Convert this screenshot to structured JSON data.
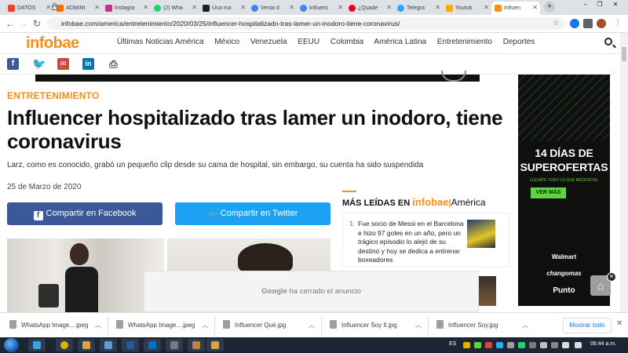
{
  "browser": {
    "tabs": [
      {
        "label": "DATOS",
        "color": "#ea4335"
      },
      {
        "label": "ADMINI",
        "color": "#ff6d00"
      },
      {
        "label": "Instagra",
        "color": "#c13584"
      },
      {
        "label": "(2) Wha",
        "color": "#25d366"
      },
      {
        "label": "Una ma",
        "color": "#202124"
      },
      {
        "label": "Venta d",
        "color": "#4285f4"
      },
      {
        "label": "Influenc",
        "color": "#4285f4"
      },
      {
        "label": "¿Quade",
        "color": "#e60023"
      },
      {
        "label": "Telegra",
        "color": "#2aabee"
      },
      {
        "label": "Youtub",
        "color": "#f9ab00"
      },
      {
        "label": "Influen",
        "color": "#f68e1e"
      }
    ],
    "url": "infobae.com/america/entretenimiento/2020/03/25/influencer-hospitalizado-tras-lamer-un-inodoro-tiene-coronavirus/"
  },
  "site": {
    "logo": "infobae",
    "nav": [
      "Últimas Noticias América",
      "México",
      "Venezuela",
      "EEUU",
      "Colombia",
      "América Latina",
      "Entretenimiento",
      "Deportes"
    ]
  },
  "social": {
    "facebook": "f",
    "linkedin": "in"
  },
  "article": {
    "section": "ENTRETENIMIENTO",
    "headline": "Influencer hospitalizado tras lamer un inodoro, tiene coronavirus",
    "dek": "Larz, como es conocido, grabó un pequeño clip desde su cama de hospital, sin embargo, su cuenta ha sido suspendida",
    "date": "25 de Marzo de 2020",
    "share_facebook": "Compartir en Facebook",
    "share_twitter": "Compartir en Twitter"
  },
  "most_read": {
    "title_prefix": "MÁS LEÍDAS EN",
    "brand": "infobae",
    "region": "América",
    "items": [
      {
        "num": "1",
        "text": "Fue socio de Messi en el Barcelona e hizo 97 goles en un año, pero un trágico episodio lo alejó de su destino y hoy se dedica a entrenar boxeadores"
      }
    ]
  },
  "closed_ad": {
    "brand": "Google",
    "text": "ha cerrado el anuncio"
  },
  "right_ad": {
    "line1": "14 DÍAS DE",
    "line2": "SUPEROFERTAS",
    "sub": "LLEVATE TODO LO QUE NECESITAS",
    "button": "VER MÁS",
    "brands": [
      "Walmart",
      "changomas",
      "Punto"
    ]
  },
  "downloads": {
    "items": [
      "WhatsApp Image....jpeg",
      "WhatsApp Image....jpeg",
      "Influencer Qué.jpg",
      "Influencer Soy II.jpg",
      "Influencer Soy.jpg"
    ],
    "show_all": "Mostrar todo"
  },
  "taskbar": {
    "lang": "ES",
    "clock": "06:44 a.m."
  }
}
